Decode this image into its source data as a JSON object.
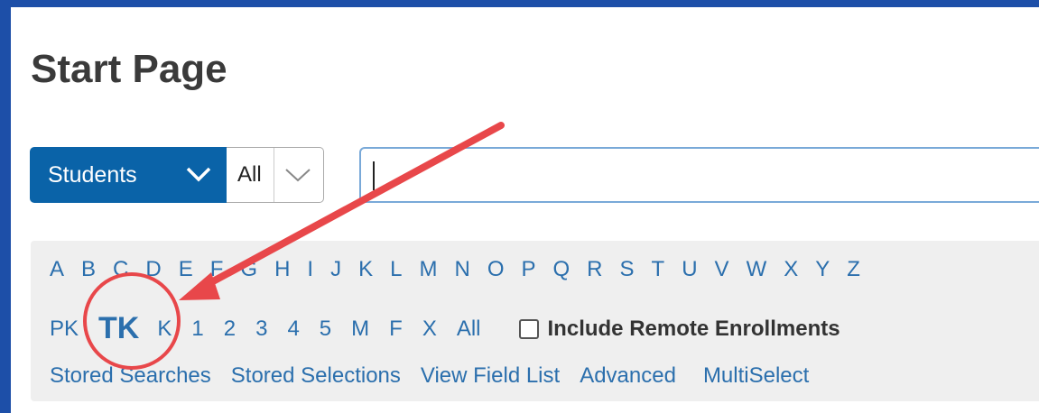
{
  "page": {
    "title": "Start Page"
  },
  "search": {
    "category_label": "Students",
    "scope_label": "All",
    "input_value": ""
  },
  "alphabet": [
    "A",
    "B",
    "C",
    "D",
    "E",
    "F",
    "G",
    "H",
    "I",
    "J",
    "K",
    "L",
    "M",
    "N",
    "O",
    "P",
    "Q",
    "R",
    "S",
    "T",
    "U",
    "V",
    "W",
    "X",
    "Y",
    "Z"
  ],
  "grades": {
    "pk": "PK",
    "tk": "TK",
    "k": "K",
    "g1": "1",
    "g2": "2",
    "g3": "3",
    "g4": "4",
    "g5": "5",
    "m": "M",
    "f": "F",
    "x": "X",
    "all": "All"
  },
  "remote": {
    "label": "Include Remote Enrollments",
    "checked": false
  },
  "links": {
    "stored_searches": "Stored Searches",
    "stored_selections": "Stored Selections",
    "view_field_list": "View Field List",
    "advanced": "Advanced",
    "multiselect": "MultiSelect"
  },
  "colors": {
    "frame_border": "#1d4fa8",
    "accent": "#0a63a8",
    "link": "#2b6fad",
    "annotation": "#e8474a"
  }
}
